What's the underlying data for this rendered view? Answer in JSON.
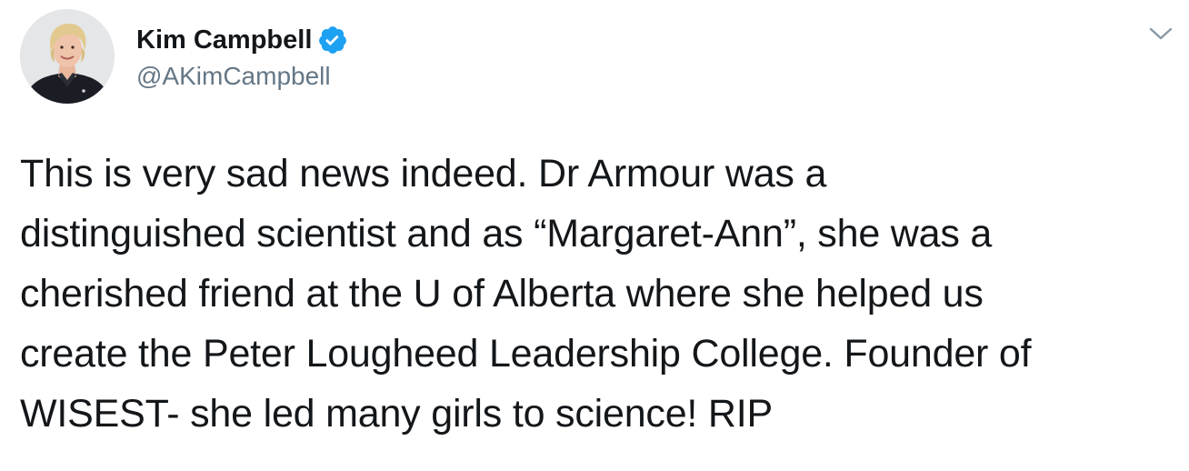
{
  "author": {
    "display_name": "Kim Campbell",
    "handle": "@AKimCampbell",
    "verified": true,
    "verified_icon": "verified-badge-icon",
    "avatar": "profile-photo"
  },
  "tweet": {
    "text": "This is very sad news indeed. Dr Armour was a\ndistinguished scientist and as “Margaret-Ann”, she was a\ncherished friend at the U of Alberta where she helped us\ncreate the Peter Lougheed Leadership College. Founder of\nWISEST- she led many girls to science! RIP"
  },
  "menu": {
    "icon": "chevron-down-icon"
  },
  "colors": {
    "verified_blue": "#1da1f2",
    "text_primary": "#14171a",
    "text_secondary": "#657786",
    "caret_gray": "#8899a6"
  }
}
